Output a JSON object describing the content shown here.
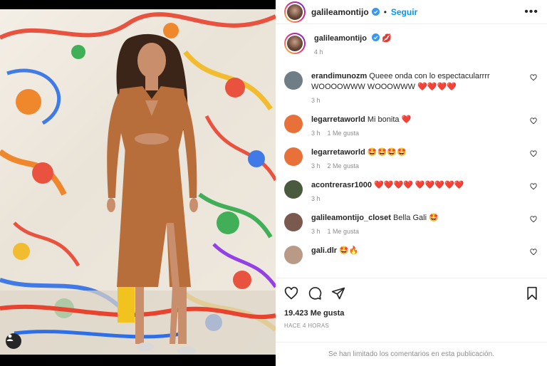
{
  "header": {
    "username": "galileamontijo",
    "follow_label": "Seguir",
    "separator": "•",
    "more_label": "•••"
  },
  "caption": {
    "username": "galileamontijo",
    "text": "💋",
    "time": "4 h"
  },
  "comments": [
    {
      "username": "erandimunozm",
      "text": "Queee onda con lo espectacularrrr WOOOOWWW WOOOWWW ❤️❤️❤️❤️",
      "time": "3 h",
      "likes": "",
      "avatar_color": "#6f7d86"
    },
    {
      "username": "legarretaworld",
      "text": "Mi bonita ❤️",
      "time": "3 h",
      "likes": "1 Me gusta",
      "avatar_color": "#e8713a"
    },
    {
      "username": "legarretaworld",
      "text": "🤩🤩🤩🤩",
      "time": "3 h",
      "likes": "2 Me gusta",
      "avatar_color": "#e8713a"
    },
    {
      "username": "acontrerasr1000",
      "text": "❤️❤️❤️❤️ ❤️❤️❤️❤️❤️",
      "time": "3 h",
      "likes": "",
      "avatar_color": "#4a5a3e"
    },
    {
      "username": "galileamontijo_closet",
      "text": "Bella Gali 🤩",
      "time": "3 h",
      "likes": "1 Me gusta",
      "avatar_color": "#7a5a4e"
    },
    {
      "username": "gali.dlr",
      "text": "🤩🔥",
      "time": "",
      "likes": "",
      "avatar_color": "#b89a86"
    }
  ],
  "post": {
    "likes": "19.423 Me gusta",
    "time": "HACE 4 HORAS",
    "limited_notice": "Se han limitado los comentarios en esta publicación."
  },
  "icons": {
    "like": "heart-icon",
    "comment": "comment-icon",
    "share": "share-icon",
    "save": "bookmark-icon",
    "tag": "user-tag-icon",
    "verified": "verified-badge-icon"
  },
  "colors": {
    "link": "#0095f6",
    "verified": "#3897f0",
    "heart": "#ed4956",
    "muted": "#8e8e8e",
    "text": "#262626"
  }
}
